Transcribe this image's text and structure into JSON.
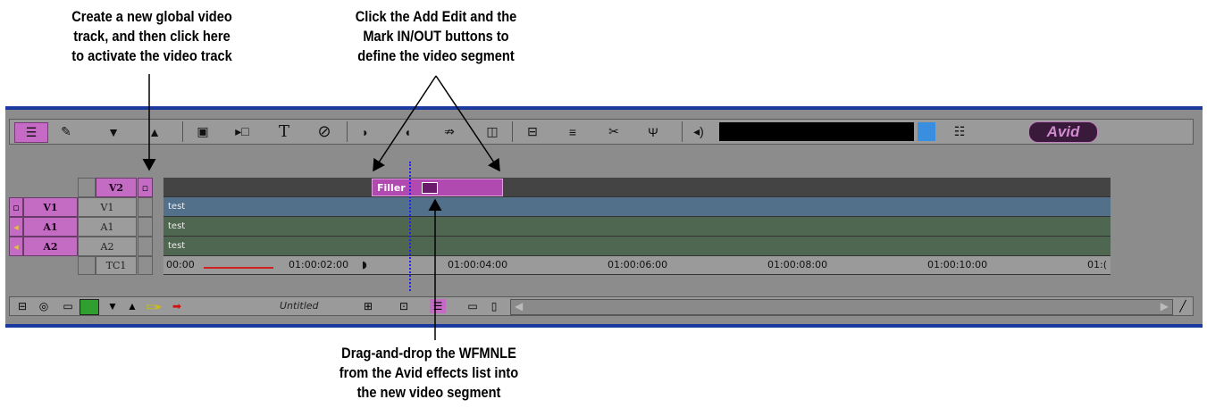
{
  "callouts": {
    "left": [
      "Create a new global video",
      "track, and then click here",
      "to activate the video track"
    ],
    "top": [
      "Click the Add Edit and the",
      "Mark IN/OUT buttons to",
      "define the video segment"
    ],
    "bottom": [
      "Drag-and-drop the WFMNLE",
      "from the Avid effects list into",
      "the new video segment"
    ]
  },
  "toolbar": {
    "icons": [
      "segment-mode-icon",
      "trim-icon",
      "lift-down-icon",
      "overwrite-up-icon",
      "effect-icon",
      "render-icon",
      "title-T-icon",
      "null-circle-icon",
      "mark-in-icon",
      "mark-out-icon",
      "add-edit-icon",
      "match-frame-icon",
      "splice-icon",
      "extract-icon",
      "cut-icon",
      "antenna-icon",
      "audio-speaker-icon",
      "composer-monitor-icon",
      "list-icon"
    ],
    "title_glyph": "T",
    "logo": "Avid"
  },
  "tracks": {
    "v2": {
      "source": "",
      "record": "V2"
    },
    "v1": {
      "source": "V1",
      "record": "V1",
      "lane_text": "test"
    },
    "a1": {
      "source": "A1",
      "record": "A1",
      "lane_text": "test"
    },
    "a2": {
      "source": "A2",
      "record": "A2",
      "lane_text": "test"
    },
    "tc": {
      "record": "TC1"
    }
  },
  "segment": {
    "label": "Filler"
  },
  "timecodes": [
    "00:00",
    "01:00:02:00",
    "01:00:04:00",
    "01:00:06:00",
    "01:00:08:00",
    "01:00:10:00",
    "01:("
  ],
  "bottombar": {
    "sequence_name": "Untitled"
  }
}
